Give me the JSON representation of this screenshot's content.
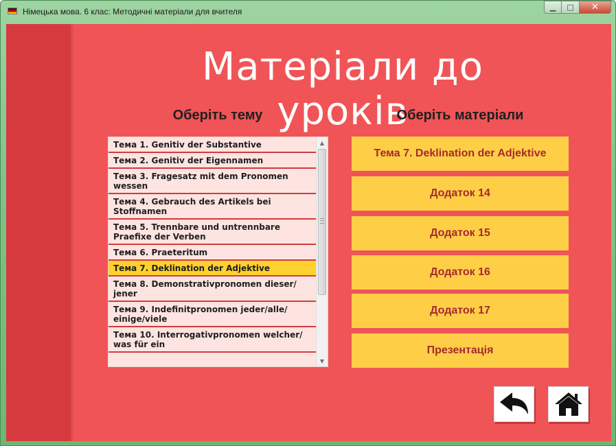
{
  "window": {
    "title": "Німецька мова. 6 клас: Методичні матеріали для вчителя",
    "controls": {
      "minimize": "▁",
      "maximize": "□",
      "close": "✕"
    }
  },
  "colors": {
    "background": "#f05457",
    "left_band": "#d63a3f",
    "list_bg": "#fde4e1",
    "list_separator": "#cf3b3f",
    "selected_topic": "#fed12e",
    "material_button": "#fecf46",
    "material_text": "#a52a2f"
  },
  "page": {
    "title": "Матеріали до уроків",
    "topics_heading": "Оберіть тему",
    "materials_heading": "Оберіть матеріали"
  },
  "topics": [
    {
      "label": "Тема 1. Genitiv der Substantive",
      "selected": false
    },
    {
      "label": "Тема 2. Genitiv der Eigennamen",
      "selected": false
    },
    {
      "label": "Тема 3. Fragesatz mit dem Pronomen wessen",
      "selected": false
    },
    {
      "label": "Тема 4. Gebrauch des Artikels bei Stoffnamen",
      "selected": false
    },
    {
      "label": "Тема 5. Trennbare und untrennbare Praefixe der Verben",
      "selected": false
    },
    {
      "label": "Тема 6. Praeteritum",
      "selected": false
    },
    {
      "label": "Тема 7. Deklination der Adjektive",
      "selected": true
    },
    {
      "label": "Тема 8. Demonstrativpronomen dieser/ jener",
      "selected": false
    },
    {
      "label": "Тема 9. Indefinitpronomen jeder/alle/ einige/viele",
      "selected": false
    },
    {
      "label": "Тема 10. Interrogativpronomen welcher/ was für ein",
      "selected": false
    }
  ],
  "scrollbar": {
    "up_arrow": "▲",
    "down_arrow": "▼",
    "position": 0
  },
  "materials": [
    "Тема 7. Deklination der Adjektive",
    "Додаток 14",
    "Додаток 15",
    "Додаток 16",
    "Додаток 17",
    "Презентація"
  ],
  "nav": {
    "back_icon": "back-arrow-icon",
    "home_icon": "home-icon"
  }
}
